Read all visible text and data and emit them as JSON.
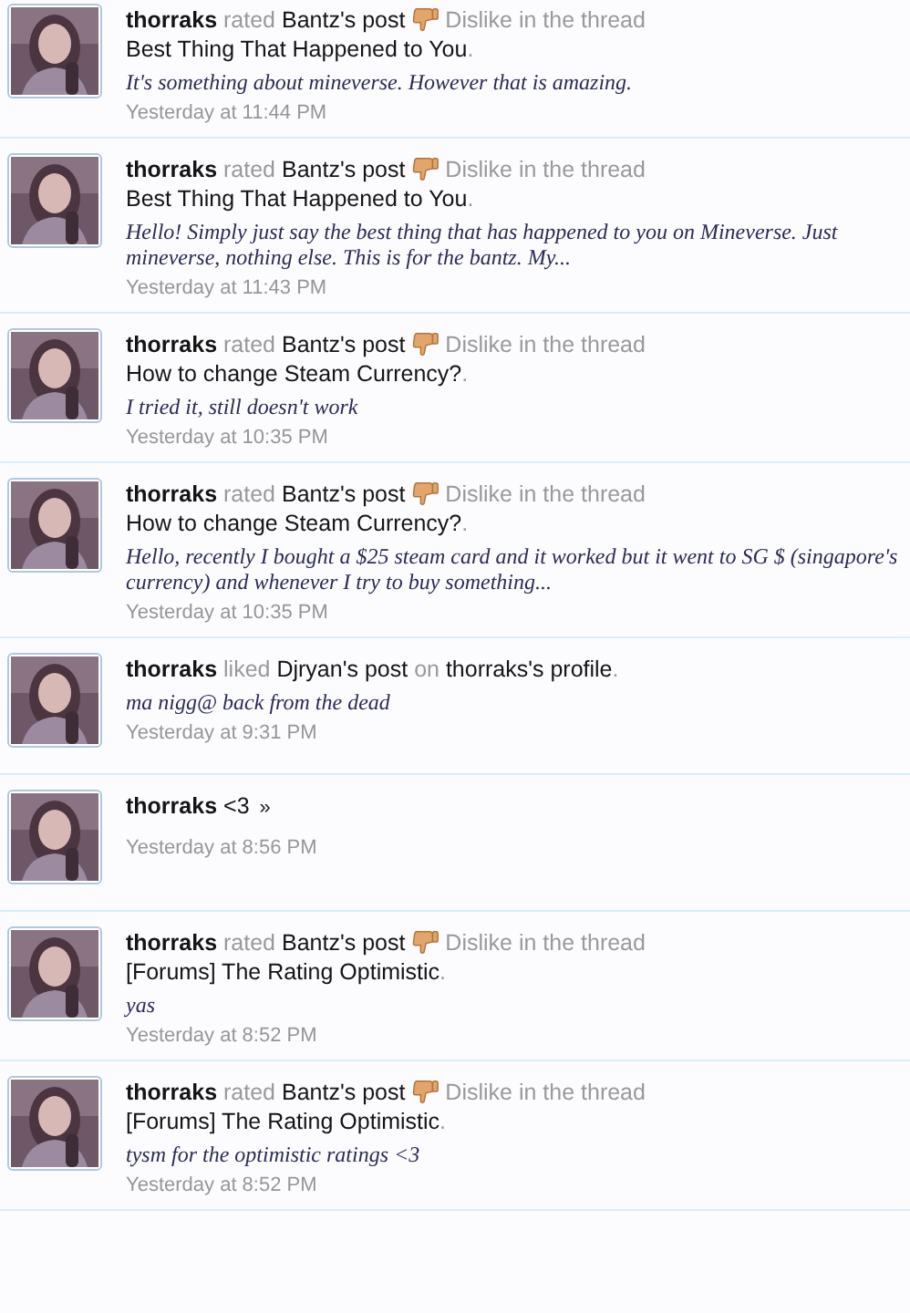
{
  "items": [
    {
      "kind": "rating",
      "user": "thorraks",
      "verb": "rated",
      "target": "Bantz's post",
      "rating": "Dislike",
      "context": "in the thread",
      "thread": "Best Thing That Happened to You",
      "end": ".",
      "snippet": "It's something about mineverse. However that is amazing.",
      "time": "Yesterday at 11:44 PM"
    },
    {
      "kind": "rating",
      "user": "thorraks",
      "verb": "rated",
      "target": "Bantz's post",
      "rating": "Dislike",
      "context": "in the thread",
      "thread": "Best Thing That Happened to You",
      "end": ".",
      "snippet": "Hello! Simply just say the best thing that has happened to you on Mineverse. Just mineverse, nothing else. This is for the bantz. My...",
      "time": "Yesterday at 11:43 PM"
    },
    {
      "kind": "rating",
      "user": "thorraks",
      "verb": "rated",
      "target": "Bantz's post",
      "rating": "Dislike",
      "context": "in the thread",
      "thread": "How to change Steam Currency?",
      "end": ".",
      "snippet": "I tried it, still doesn't work",
      "time": "Yesterday at 10:35 PM"
    },
    {
      "kind": "rating",
      "user": "thorraks",
      "verb": "rated",
      "target": "Bantz's post",
      "rating": "Dislike",
      "context": "in the thread",
      "thread": "How to change Steam Currency?",
      "end": ".",
      "snippet": "Hello, recently I bought a $25 steam card and it worked but it went to SG $ (singapore's currency) and whenever I try to buy something...",
      "time": "Yesterday at 10:35 PM"
    },
    {
      "kind": "like",
      "user": "thorraks",
      "verb": "liked",
      "target": "Djryan's post",
      "context": "on",
      "thread": "thorraks's profile",
      "end": ".",
      "snippet": "ma nigg@ back from the dead",
      "time": "Yesterday at 9:31 PM"
    },
    {
      "kind": "status",
      "user": "thorraks",
      "message": "<3",
      "more": "»",
      "time": "Yesterday at 8:56 PM"
    },
    {
      "kind": "rating",
      "user": "thorraks",
      "verb": "rated",
      "target": "Bantz's post",
      "rating": "Dislike",
      "context": "in the thread",
      "thread": "[Forums] The Rating Optimistic",
      "end": ".",
      "snippet": "yas",
      "time": "Yesterday at 8:52 PM"
    },
    {
      "kind": "rating",
      "user": "thorraks",
      "verb": "rated",
      "target": "Bantz's post",
      "rating": "Dislike",
      "context": "in the thread",
      "thread": "[Forums] The Rating Optimistic",
      "end": ".",
      "snippet": "tysm for the optimistic ratings <3",
      "time": "Yesterday at 8:52 PM"
    }
  ]
}
